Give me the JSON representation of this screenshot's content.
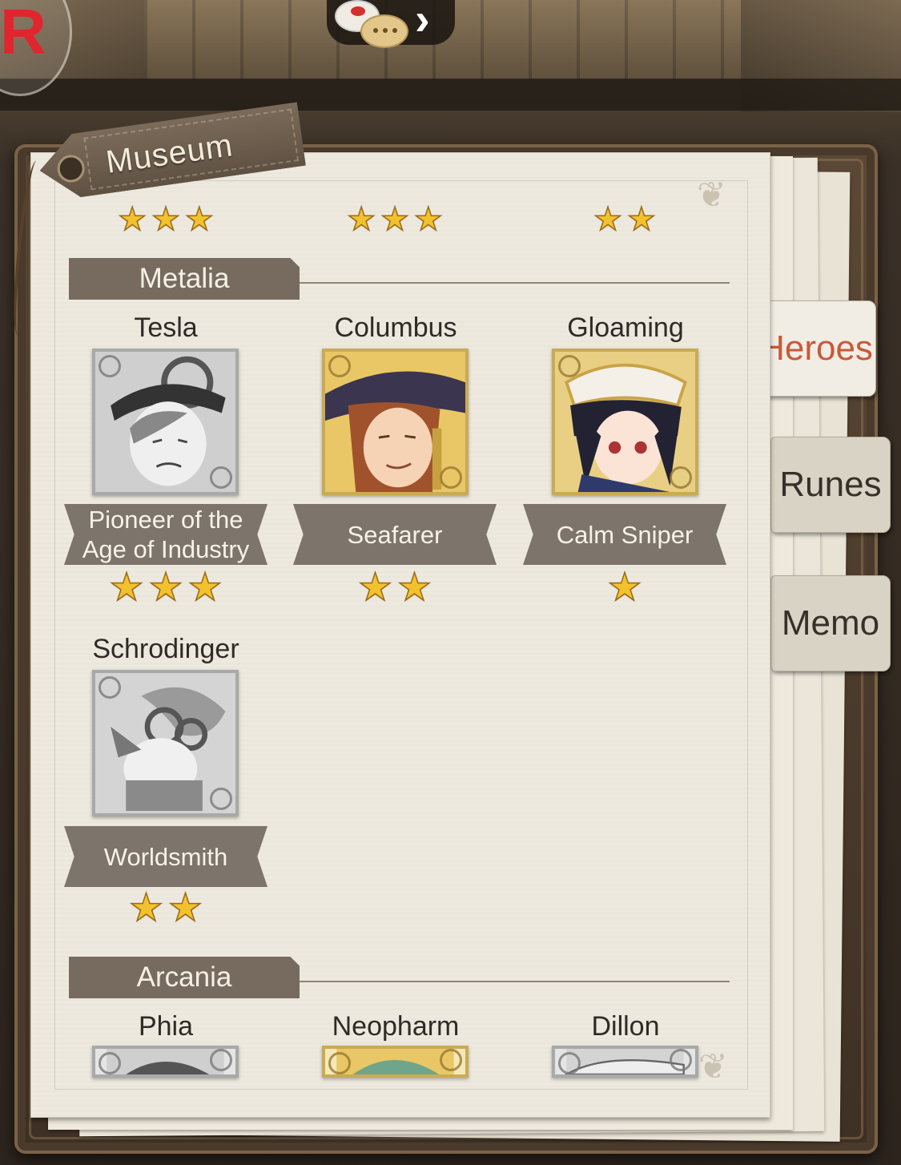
{
  "app": {
    "logo_letter": "R"
  },
  "header": {
    "title": "Museum"
  },
  "tabs": [
    {
      "label": "Heroes",
      "active": true
    },
    {
      "label": "Runes",
      "active": false
    },
    {
      "label": "Memo",
      "active": false
    }
  ],
  "top_stars": [
    3,
    3,
    2
  ],
  "sections": [
    {
      "name": "Metalia",
      "heroes": [
        {
          "name": "Tesla",
          "title": "Pioneer of the Age of Industry",
          "stars": 3,
          "owned": false,
          "icon": "tesla-portrait"
        },
        {
          "name": "Columbus",
          "title": "Seafarer",
          "stars": 2,
          "owned": true,
          "icon": "columbus-portrait"
        },
        {
          "name": "Gloaming",
          "title": "Calm Sniper",
          "stars": 1,
          "owned": true,
          "icon": "gloaming-portrait"
        },
        {
          "name": "Schrodinger",
          "title": "Worldsmith",
          "stars": 2,
          "owned": false,
          "icon": "schrodinger-portrait"
        }
      ]
    },
    {
      "name": "Arcania",
      "heroes": [
        {
          "name": "Phia",
          "owned": false,
          "icon": "phia-portrait"
        },
        {
          "name": "Neopharm",
          "owned": true,
          "icon": "neopharm-portrait"
        },
        {
          "name": "Dillon",
          "owned": false,
          "icon": "dillon-portrait"
        }
      ]
    }
  ],
  "colors": {
    "active_tab": "#c75a3a",
    "star_fill": "#f2c12e",
    "owned_frame": "#c9ab55",
    "locked_frame": "#a9a9a9"
  }
}
